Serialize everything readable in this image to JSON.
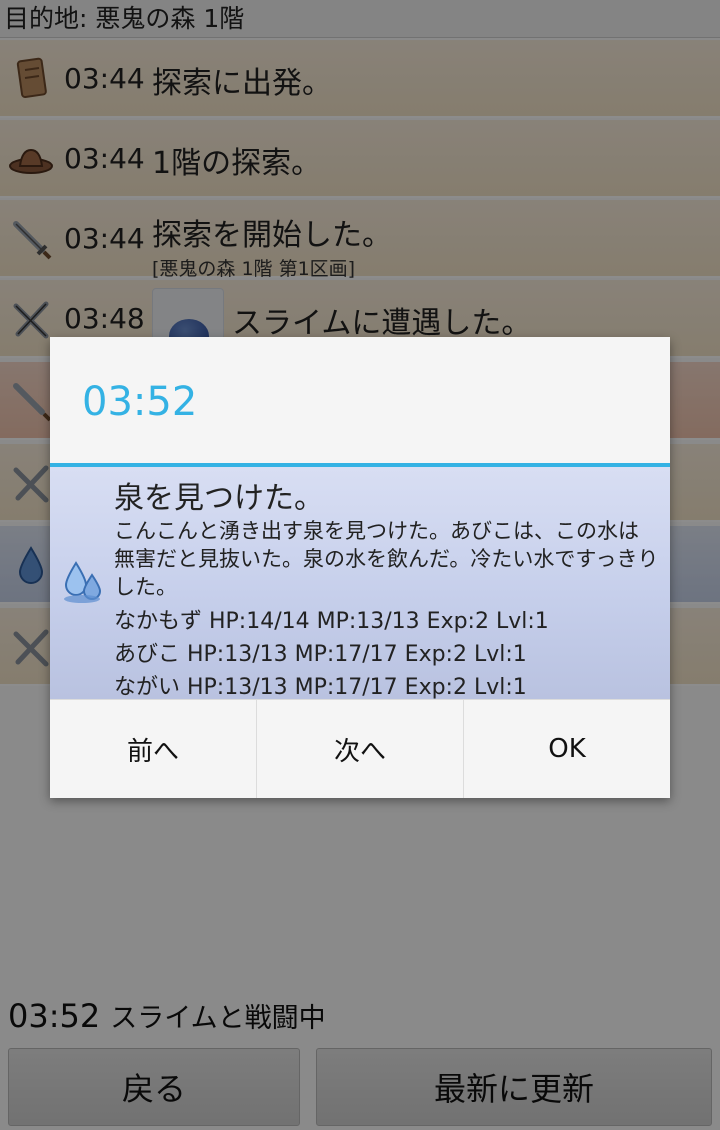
{
  "header": {
    "destination": "目的地: 悪鬼の森 1階"
  },
  "log": [
    {
      "time": "03:44",
      "text": "探索に出発。",
      "sub": "",
      "icon": "scroll-icon"
    },
    {
      "time": "03:44",
      "text": "1階の探索。",
      "sub": "",
      "icon": "hat-icon"
    },
    {
      "time": "03:44",
      "text": "探索を開始した。",
      "sub": "[悪鬼の森 1階 第1区画]",
      "icon": "sword-icon"
    },
    {
      "time": "03:48",
      "text": "スライムに遭遇した。",
      "sub": "",
      "icon": "crossed-swords-icon"
    }
  ],
  "status": {
    "time": "03:52",
    "message": "スライムと戦闘中"
  },
  "buttons": {
    "back": "戻る",
    "refresh": "最新に更新"
  },
  "dialog": {
    "title": "03:52",
    "heading": "泉を見つけた。",
    "body": "こんこんと湧き出す泉を見つけた。あびこは、この水は無害だと見抜いた。泉の水を飲んだ。冷たい水ですっきりした。",
    "stats": [
      "なかもず HP:14/14 MP:13/13 Exp:2 Lvl:1",
      "あびこ HP:13/13 MP:17/17 Exp:2 Lvl:1",
      "ながい HP:13/13 MP:17/17 Exp:2 Lvl:1"
    ],
    "buttons": {
      "prev": "前へ",
      "next": "次へ",
      "ok": "OK"
    },
    "icon": "water-drop-icon"
  },
  "colors": {
    "accent": "#34b2e4",
    "dim": "rgba(0,0,0,0.45)"
  }
}
